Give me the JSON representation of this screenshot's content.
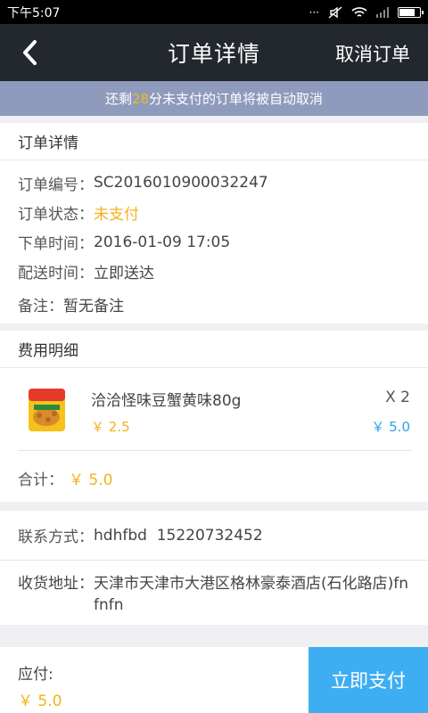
{
  "status_bar": {
    "time": "下午5:07",
    "dots": "···",
    "wifi": "WiFi",
    "battery_level": 0.85
  },
  "nav": {
    "title": "订单详情",
    "cancel_label": "取消订单"
  },
  "notice": {
    "prefix": "还剩",
    "minutes": "28",
    "suffix": "分未支付的订单将被自动取消"
  },
  "order_info": {
    "header": "订单详情",
    "order_no_label": "订单编号：",
    "order_no": "SC2016010900032247",
    "status_label": "订单状态：",
    "status": "未支付",
    "time_label": "下单时间：",
    "time": "2016-01-09 17:05",
    "delivery_label": "配送时间：",
    "delivery": "立即送达",
    "note_label": "备注：",
    "note": "暂无备注"
  },
  "fees": {
    "header": "费用明细",
    "item": {
      "name": "洽洽怪味豆蟹黄味80g",
      "price": "￥ 2.5",
      "qty": "X 2",
      "subtotal": "￥ 5.0"
    },
    "total_label": "合计：",
    "total": "￥ 5.0"
  },
  "contact": {
    "label": "联系方式：",
    "value": "hdhfbd  15220732452",
    "address_label": "收货地址：",
    "address": "天津市天津市大港区格林豪泰酒店(石化路店)fnfnfn"
  },
  "bottom": {
    "due_label": "应付:",
    "due": "￥ 5.0",
    "pay_label": "立即支付"
  },
  "colors": {
    "accent": "#3eaef2",
    "price": "#f3b21c",
    "nav": "#23272e",
    "notice": "#8e9bbd"
  }
}
